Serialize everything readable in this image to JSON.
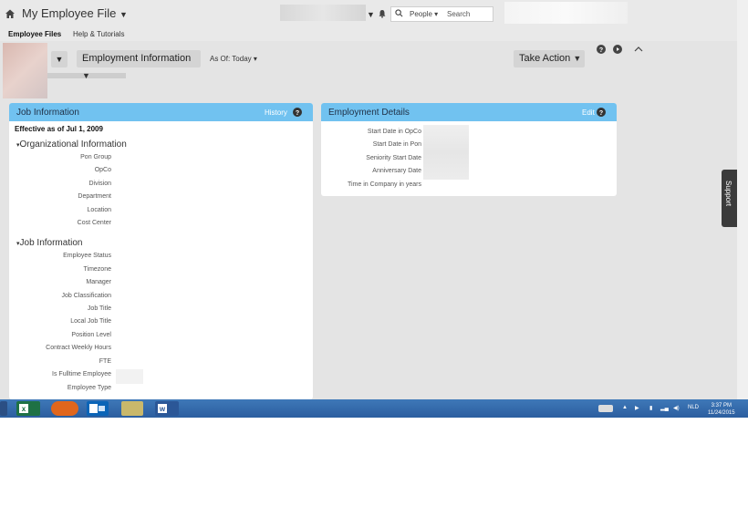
{
  "app": {
    "title": "My Employee File"
  },
  "search": {
    "scope": "People",
    "placeholder": "Search"
  },
  "subnav": {
    "items": [
      "Employee Files",
      "Help & Tutorials"
    ]
  },
  "header": {
    "section_dropdown": "Employment Information",
    "as_of": "As Of: Today",
    "take_action": "Take Action"
  },
  "job_panel": {
    "title": "Job Information",
    "link": "History",
    "effective": "Effective as of Jul 1, 2009",
    "sections": [
      {
        "title": "Organizational Information",
        "fields": [
          "Pon Group",
          "OpCo",
          "Division",
          "Department",
          "Location",
          "Cost Center"
        ]
      },
      {
        "title": "Job Information",
        "fields": [
          "Employee Status",
          "Timezone",
          "Manager",
          "Job Classification",
          "Job Title",
          "Local Job Title",
          "Position Level",
          "Contract Weekly Hours",
          "FTE",
          "Is Fulltime Employee",
          "Employee Type"
        ]
      }
    ]
  },
  "employment_panel": {
    "title": "Employment Details",
    "link": "Edit",
    "fields": [
      "Start Date in OpCo",
      "Start Date in Pon",
      "Seniority Start Date",
      "Anniversary Date",
      "Time in Company in years"
    ]
  },
  "support_tab": "Support",
  "taskbar": {
    "language": "NLD",
    "time": "3:37 PM",
    "date": "11/24/2015"
  },
  "icons": [
    "home-icon",
    "bell-icon",
    "search-icon",
    "help-icon",
    "play-icon",
    "collapse-icon"
  ],
  "colors": {
    "panel_header": "#71c2f0",
    "taskbar": "#2c5e9f",
    "background": "#e4e4e4"
  }
}
